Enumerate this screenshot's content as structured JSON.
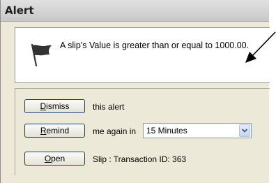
{
  "window": {
    "title": "Alert"
  },
  "message": {
    "text": "A slip's Value is greater than or equal to 1000.00."
  },
  "actions": {
    "dismiss": {
      "button_accesskey": "D",
      "button_rest": "ismiss",
      "text": "this alert"
    },
    "remind": {
      "button_accesskey": "R",
      "button_rest": "emind",
      "text": "me again in",
      "selected_interval": "15 Minutes"
    },
    "open": {
      "button_accesskey": "O",
      "button_rest": "pen",
      "text": "Slip : Transaction ID: 363"
    }
  }
}
